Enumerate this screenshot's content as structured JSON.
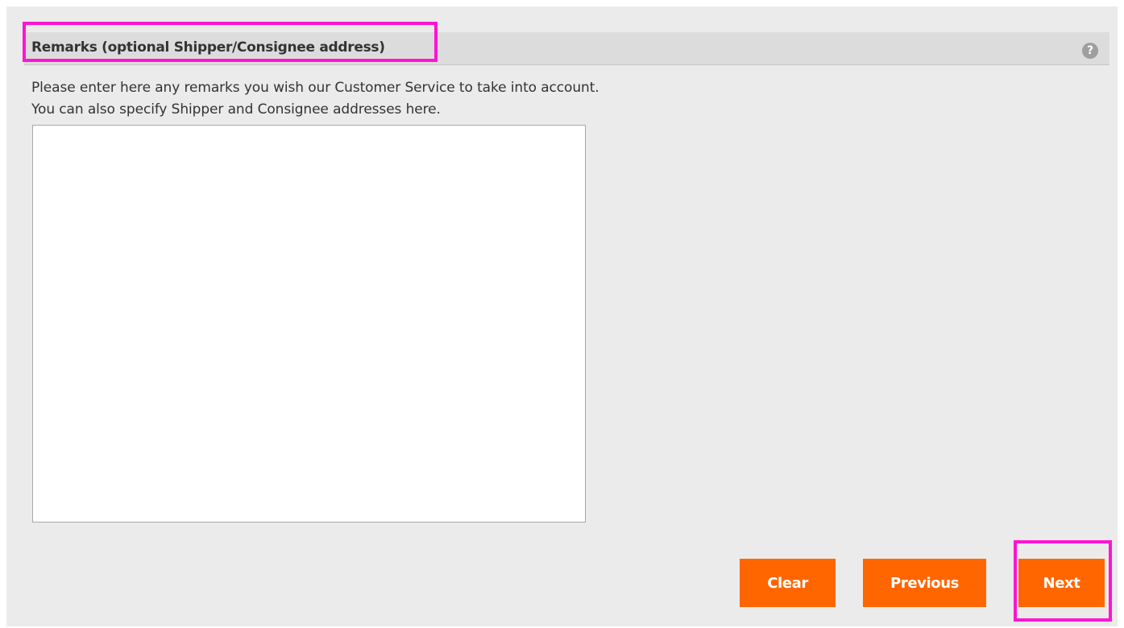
{
  "section": {
    "title": "Remarks (optional Shipper/Consignee address)",
    "help_icon_glyph": "?"
  },
  "description": {
    "line1": "Please enter here any remarks you wish our Customer Service to take into account.",
    "line2": "You can also specify Shipper and Consignee addresses here."
  },
  "remarks": {
    "value": "",
    "placeholder": ""
  },
  "buttons": {
    "clear_label": "Clear",
    "previous_label": "Previous",
    "next_label": "Next"
  },
  "colors": {
    "button_bg": "#ff6600",
    "highlight": "#ff14d2",
    "panel_bg": "#ebebeb",
    "header_bg": "#dcdcdc"
  },
  "icons": {
    "help": "help-icon"
  }
}
